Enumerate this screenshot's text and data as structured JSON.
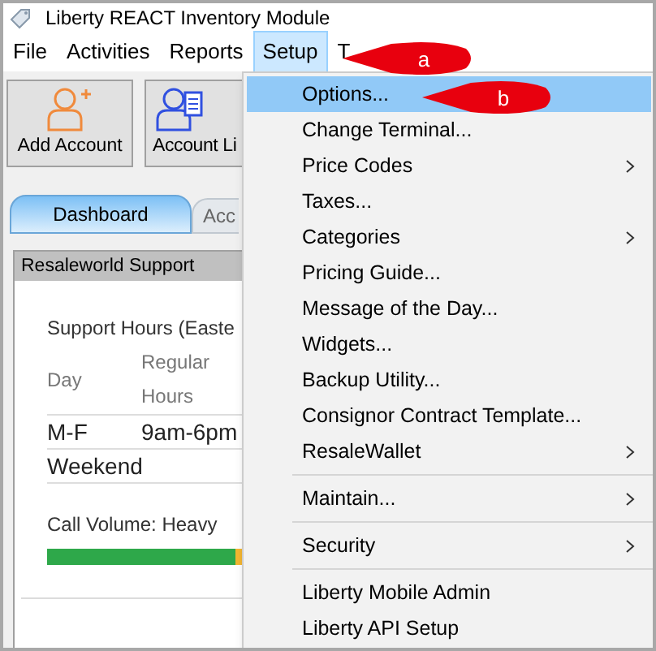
{
  "window": {
    "title": "Liberty REACT Inventory Module"
  },
  "menu_bar": [
    {
      "label": "File",
      "selected": false
    },
    {
      "label": "Activities",
      "selected": false
    },
    {
      "label": "Reports",
      "selected": false
    },
    {
      "label": "Setup",
      "selected": true
    },
    {
      "label": "T",
      "selected": false
    }
  ],
  "toolbar": [
    {
      "label": "Add Account",
      "kind": "add"
    },
    {
      "label": "Account Li",
      "kind": "list"
    }
  ],
  "tabs": [
    {
      "label": "Dashboard",
      "selected": true
    },
    {
      "label": "Acc",
      "selected": false
    }
  ],
  "panel": {
    "title": "Resaleworld Support",
    "heading": "Support Hours (Easte",
    "columns": [
      "Day",
      "Regular Hours"
    ],
    "rows": [
      [
        "M-F",
        "9am-6pm"
      ],
      [
        "Weekend"
      ]
    ],
    "call_volume": "Call Volume: Heavy",
    "level": 0.97
  },
  "setup_menu": [
    {
      "kind": "item",
      "label": "Options...",
      "submenu": false,
      "selected": true
    },
    {
      "kind": "item",
      "label": "Change Terminal...",
      "submenu": false,
      "selected": false
    },
    {
      "kind": "item",
      "label": "Price Codes",
      "submenu": true,
      "selected": false
    },
    {
      "kind": "item",
      "label": "Taxes...",
      "submenu": false,
      "selected": false
    },
    {
      "kind": "item",
      "label": "Categories",
      "submenu": true,
      "selected": false
    },
    {
      "kind": "item",
      "label": "Pricing Guide...",
      "submenu": false,
      "selected": false
    },
    {
      "kind": "item",
      "label": "Message of the Day...",
      "submenu": false,
      "selected": false
    },
    {
      "kind": "item",
      "label": "Widgets...",
      "submenu": false,
      "selected": false
    },
    {
      "kind": "item",
      "label": "Backup Utility...",
      "submenu": false,
      "selected": false
    },
    {
      "kind": "item",
      "label": "Consignor Contract Template...",
      "submenu": false,
      "selected": false
    },
    {
      "kind": "item",
      "label": "ResaleWallet",
      "submenu": true,
      "selected": false
    },
    {
      "kind": "separator"
    },
    {
      "kind": "item",
      "label": "Maintain...",
      "submenu": true,
      "selected": false
    },
    {
      "kind": "separator"
    },
    {
      "kind": "item",
      "label": "Security",
      "submenu": true,
      "selected": false
    },
    {
      "kind": "separator"
    },
    {
      "kind": "item",
      "label": "Liberty Mobile Admin",
      "submenu": false,
      "selected": false
    },
    {
      "kind": "item",
      "label": "Liberty API Setup",
      "submenu": false,
      "selected": false
    }
  ],
  "callouts": [
    {
      "label": "a"
    },
    {
      "label": "b"
    }
  ]
}
